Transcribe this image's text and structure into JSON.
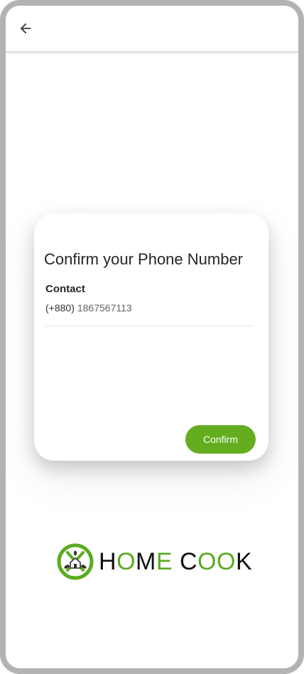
{
  "header": {
    "back_icon": "arrow-left-icon"
  },
  "card": {
    "title": "Confirm your Phone Number",
    "contact_label": "Contact",
    "country_code": "(+880)",
    "phone_number": "1867567113",
    "confirm_label": "Confirm"
  },
  "brand": {
    "logo_icon": "home-cook-logo-icon",
    "letters": [
      {
        "char": "H",
        "color": "dark"
      },
      {
        "char": "O",
        "color": "green"
      },
      {
        "char": "M",
        "color": "dark"
      },
      {
        "char": "E",
        "color": "green"
      },
      {
        "char": " ",
        "color": "dark"
      },
      {
        "char": "C",
        "color": "dark"
      },
      {
        "char": "O",
        "color": "green"
      },
      {
        "char": "O",
        "color": "green"
      },
      {
        "char": "K",
        "color": "dark"
      }
    ]
  },
  "colors": {
    "accent": "#64ad1f",
    "brand_green": "#5aab1f",
    "text_dark": "#262626",
    "frame": "#b3b3b3"
  }
}
